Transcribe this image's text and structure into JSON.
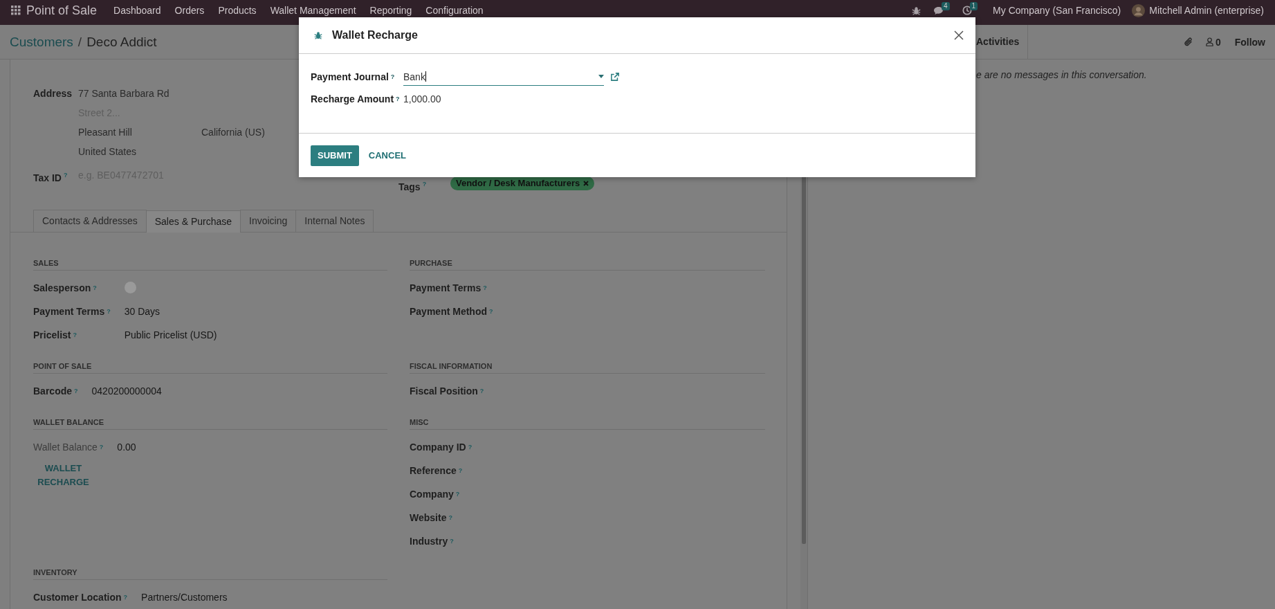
{
  "navbar": {
    "app_name": "Point of Sale",
    "menu": [
      "Dashboard",
      "Orders",
      "Products",
      "Wallet Management",
      "Reporting",
      "Configuration"
    ],
    "chat_count": "4",
    "activity_count": "1",
    "company": "My Company (San Francisco)",
    "user": "Mitchell Admin (enterprise)"
  },
  "breadcrumb": {
    "items": [
      "Customers",
      "Deco Addict"
    ],
    "separator": "/"
  },
  "address": {
    "label": "Address",
    "street": "77 Santa Barbara Rd",
    "street2": {
      "placeholder": "Street 2..."
    },
    "city": "Pleasant Hill",
    "state": "California (US)",
    "country": "United States"
  },
  "tax_id": {
    "label": "Tax ID",
    "help": "?",
    "placeholder": "e.g. BE0477472701"
  },
  "tags": {
    "label": "Tags",
    "help": "?",
    "items": [
      "Vendor / Desk Manufacturers"
    ]
  },
  "tabs": [
    {
      "label": "Contacts & Addresses",
      "selected": false
    },
    {
      "label": "Sales & Purchase",
      "selected": true
    },
    {
      "label": "Invoicing",
      "selected": false
    },
    {
      "label": "Internal Notes",
      "selected": false
    }
  ],
  "section_rows": [
    {
      "left": {
        "title": "SALES",
        "fields": [
          {
            "kind": "avatar",
            "label": "Salesperson",
            "help": "?"
          },
          {
            "kind": "text",
            "label": "Payment Terms",
            "help": "?",
            "value": "30 Days"
          },
          {
            "kind": "text",
            "label": "Pricelist",
            "help": "?",
            "value": "Public Pricelist (USD)"
          }
        ]
      },
      "right": {
        "title": "PURCHASE",
        "fields": [
          {
            "kind": "text",
            "label": "Payment Terms",
            "help": "?"
          },
          {
            "kind": "text",
            "label": "Payment Method",
            "help": "?"
          }
        ]
      }
    },
    {
      "left": {
        "title": "POINT OF SALE",
        "fields": [
          {
            "kind": "text",
            "label": "Barcode",
            "help": "?",
            "value": "0420200000004"
          }
        ]
      },
      "right": {
        "title": "FISCAL INFORMATION",
        "fields": [
          {
            "kind": "text",
            "label": "Fiscal Position",
            "help": "?"
          }
        ]
      }
    },
    {
      "left": {
        "title": "WALLET BALANCE",
        "fields": [
          {
            "kind": "readonly",
            "label": "Wallet Balance",
            "help": "?",
            "value": "0.00"
          },
          {
            "kind": "button",
            "label": "WALLET RECHARGE"
          }
        ]
      },
      "right": {
        "title": "MISC",
        "fields": [
          {
            "kind": "text",
            "label": "Company ID",
            "help": "?"
          },
          {
            "kind": "text",
            "label": "Reference",
            "help": "?"
          },
          {
            "kind": "text",
            "label": "Company",
            "help": "?"
          },
          {
            "kind": "text",
            "label": "Website",
            "help": "?"
          },
          {
            "kind": "text",
            "label": "Industry",
            "help": "?"
          }
        ]
      }
    },
    {
      "left": {
        "title": "INVENTORY",
        "fields": [
          {
            "kind": "text",
            "label": "Customer Location",
            "help": "?",
            "value": "Partners/Customers"
          }
        ]
      }
    }
  ],
  "chatter": {
    "tab": "Activities",
    "follower_count": "0",
    "follow": "Follow",
    "empty_message": "e are no messages in this conversation."
  },
  "dialog": {
    "title": "Wallet Recharge",
    "fields": [
      {
        "kind": "select",
        "label": "Payment Journal",
        "help": "?",
        "value": "Bank"
      },
      {
        "kind": "text",
        "label": "Recharge Amount",
        "help": "?",
        "value": "1,000.00"
      }
    ],
    "buttons": [
      {
        "kind": "primary",
        "label": "SUBMIT"
      },
      {
        "kind": "secondary",
        "label": "CANCEL"
      }
    ]
  }
}
